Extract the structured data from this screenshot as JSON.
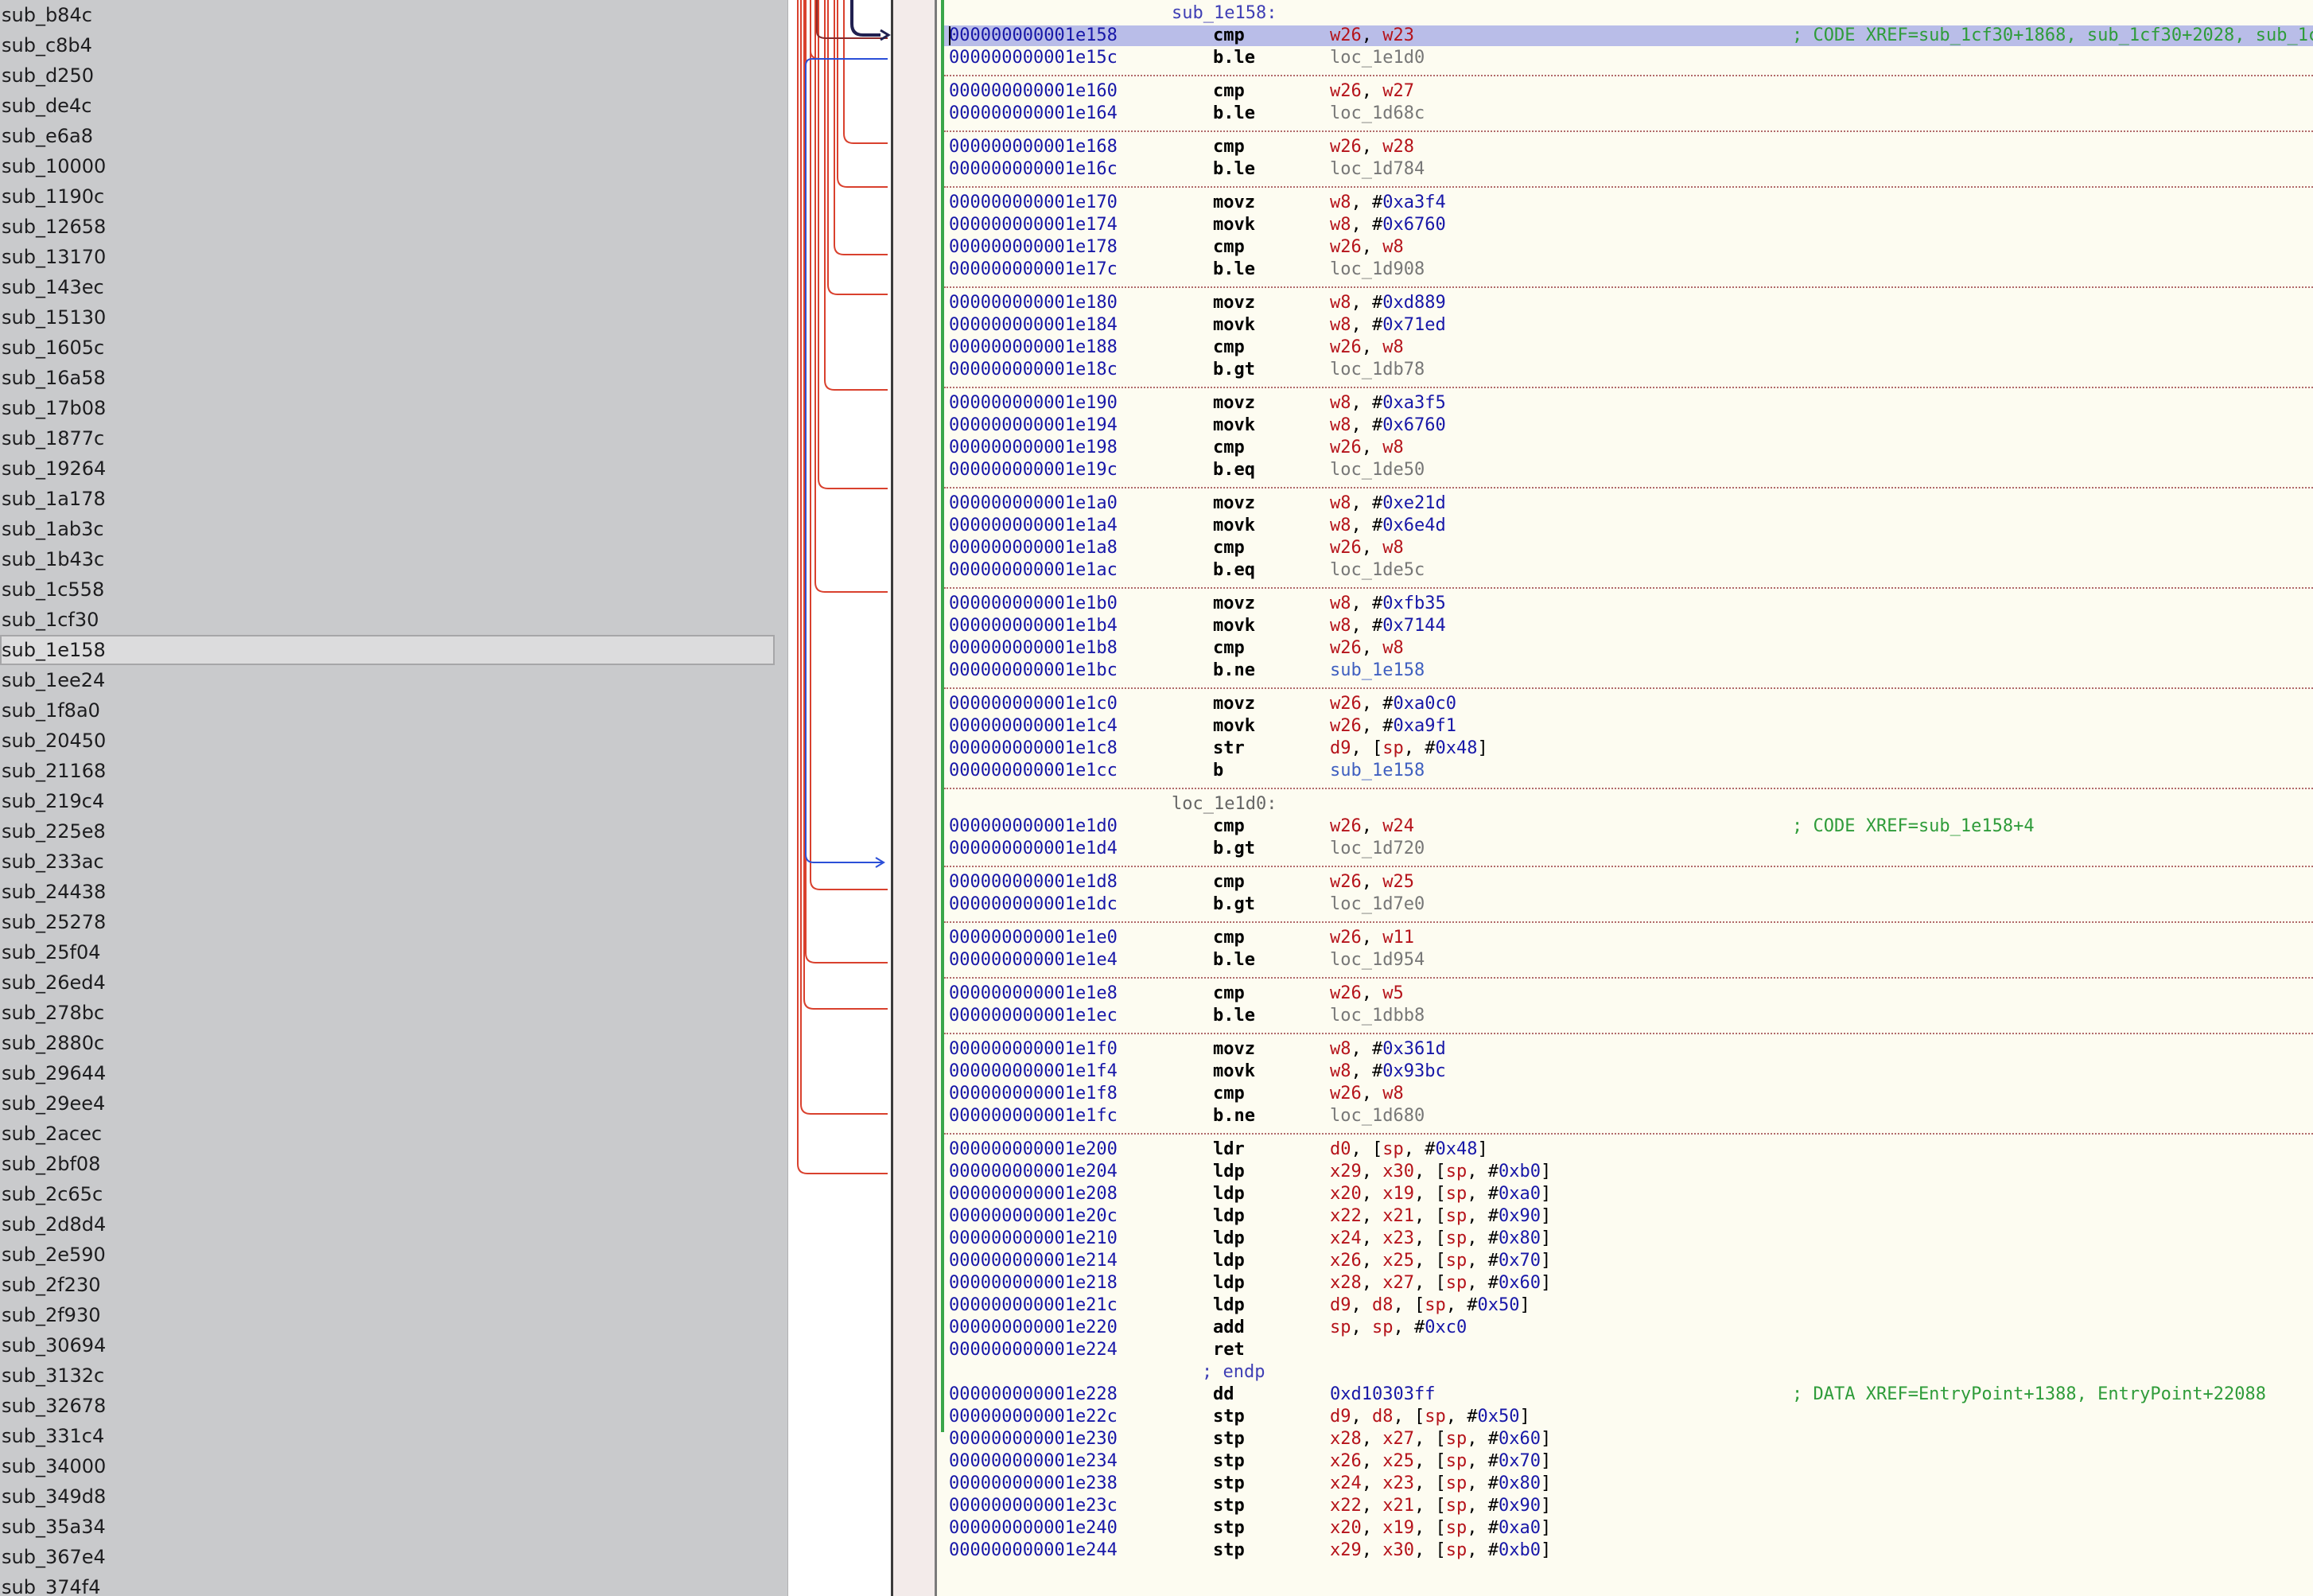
{
  "sidebar": {
    "items": [
      "sub_b84c",
      "sub_c8b4",
      "sub_d250",
      "sub_de4c",
      "sub_e6a8",
      "sub_10000",
      "sub_1190c",
      "sub_12658",
      "sub_13170",
      "sub_143ec",
      "sub_15130",
      "sub_1605c",
      "sub_16a58",
      "sub_17b08",
      "sub_1877c",
      "sub_19264",
      "sub_1a178",
      "sub_1ab3c",
      "sub_1b43c",
      "sub_1c558",
      "sub_1cf30",
      "sub_1e158",
      "sub_1ee24",
      "sub_1f8a0",
      "sub_20450",
      "sub_21168",
      "sub_219c4",
      "sub_225e8",
      "sub_233ac",
      "sub_24438",
      "sub_25278",
      "sub_25f04",
      "sub_26ed4",
      "sub_278bc",
      "sub_2880c",
      "sub_29644",
      "sub_29ee4",
      "sub_2acec",
      "sub_2bf08",
      "sub_2c65c",
      "sub_2d8d4",
      "sub_2e590",
      "sub_2f230",
      "sub_2f930",
      "sub_30694",
      "sub_3132c",
      "sub_32678",
      "sub_331c4",
      "sub_34000",
      "sub_349d8",
      "sub_35a34",
      "sub_367e4",
      "sub_374f4"
    ],
    "selected_index": 21
  },
  "listing": {
    "lines": [
      {
        "kind": "label",
        "text": "sub_1e158:"
      },
      {
        "kind": "code",
        "addr": "000000000001e158",
        "mn": "cmp",
        "ops": "w26, w23",
        "comment": "; CODE XREF=sub_1cf30+1868, sub_1cf30+2028, sub_1c",
        "hl": true
      },
      {
        "kind": "code",
        "addr": "000000000001e15c",
        "mn": "b.le",
        "ops": "loc_1e1d0"
      },
      {
        "kind": "sep"
      },
      {
        "kind": "code",
        "addr": "000000000001e160",
        "mn": "cmp",
        "ops": "w26, w27"
      },
      {
        "kind": "code",
        "addr": "000000000001e164",
        "mn": "b.le",
        "ops": "loc_1d68c"
      },
      {
        "kind": "sep"
      },
      {
        "kind": "code",
        "addr": "000000000001e168",
        "mn": "cmp",
        "ops": "w26, w28"
      },
      {
        "kind": "code",
        "addr": "000000000001e16c",
        "mn": "b.le",
        "ops": "loc_1d784"
      },
      {
        "kind": "sep"
      },
      {
        "kind": "code",
        "addr": "000000000001e170",
        "mn": "movz",
        "ops": "w8, #0xa3f4"
      },
      {
        "kind": "code",
        "addr": "000000000001e174",
        "mn": "movk",
        "ops": "w8, #0x6760"
      },
      {
        "kind": "code",
        "addr": "000000000001e178",
        "mn": "cmp",
        "ops": "w26, w8"
      },
      {
        "kind": "code",
        "addr": "000000000001e17c",
        "mn": "b.le",
        "ops": "loc_1d908"
      },
      {
        "kind": "sep"
      },
      {
        "kind": "code",
        "addr": "000000000001e180",
        "mn": "movz",
        "ops": "w8, #0xd889"
      },
      {
        "kind": "code",
        "addr": "000000000001e184",
        "mn": "movk",
        "ops": "w8, #0x71ed"
      },
      {
        "kind": "code",
        "addr": "000000000001e188",
        "mn": "cmp",
        "ops": "w26, w8"
      },
      {
        "kind": "code",
        "addr": "000000000001e18c",
        "mn": "b.gt",
        "ops": "loc_1db78"
      },
      {
        "kind": "sep"
      },
      {
        "kind": "code",
        "addr": "000000000001e190",
        "mn": "movz",
        "ops": "w8, #0xa3f5"
      },
      {
        "kind": "code",
        "addr": "000000000001e194",
        "mn": "movk",
        "ops": "w8, #0x6760"
      },
      {
        "kind": "code",
        "addr": "000000000001e198",
        "mn": "cmp",
        "ops": "w26, w8"
      },
      {
        "kind": "code",
        "addr": "000000000001e19c",
        "mn": "b.eq",
        "ops": "loc_1de50"
      },
      {
        "kind": "sep"
      },
      {
        "kind": "code",
        "addr": "000000000001e1a0",
        "mn": "movz",
        "ops": "w8, #0xe21d"
      },
      {
        "kind": "code",
        "addr": "000000000001e1a4",
        "mn": "movk",
        "ops": "w8, #0x6e4d"
      },
      {
        "kind": "code",
        "addr": "000000000001e1a8",
        "mn": "cmp",
        "ops": "w26, w8"
      },
      {
        "kind": "code",
        "addr": "000000000001e1ac",
        "mn": "b.eq",
        "ops": "loc_1de5c"
      },
      {
        "kind": "sep"
      },
      {
        "kind": "code",
        "addr": "000000000001e1b0",
        "mn": "movz",
        "ops": "w8, #0xfb35"
      },
      {
        "kind": "code",
        "addr": "000000000001e1b4",
        "mn": "movk",
        "ops": "w8, #0x7144"
      },
      {
        "kind": "code",
        "addr": "000000000001e1b8",
        "mn": "cmp",
        "ops": "w26, w8"
      },
      {
        "kind": "code",
        "addr": "000000000001e1bc",
        "mn": "b.ne",
        "ops": "sub_1e158"
      },
      {
        "kind": "sep"
      },
      {
        "kind": "code",
        "addr": "000000000001e1c0",
        "mn": "movz",
        "ops": "w26, #0xa0c0"
      },
      {
        "kind": "code",
        "addr": "000000000001e1c4",
        "mn": "movk",
        "ops": "w26, #0xa9f1"
      },
      {
        "kind": "code",
        "addr": "000000000001e1c8",
        "mn": "str",
        "ops": "d9, [sp, #0x48]"
      },
      {
        "kind": "code",
        "addr": "000000000001e1cc",
        "mn": "b",
        "ops": "sub_1e158"
      },
      {
        "kind": "sep"
      },
      {
        "kind": "label",
        "text": "loc_1e1d0:",
        "loc": true
      },
      {
        "kind": "code",
        "addr": "000000000001e1d0",
        "mn": "cmp",
        "ops": "w26, w24",
        "comment": "; CODE XREF=sub_1e158+4"
      },
      {
        "kind": "code",
        "addr": "000000000001e1d4",
        "mn": "b.gt",
        "ops": "loc_1d720"
      },
      {
        "kind": "sep"
      },
      {
        "kind": "code",
        "addr": "000000000001e1d8",
        "mn": "cmp",
        "ops": "w26, w25"
      },
      {
        "kind": "code",
        "addr": "000000000001e1dc",
        "mn": "b.gt",
        "ops": "loc_1d7e0"
      },
      {
        "kind": "sep"
      },
      {
        "kind": "code",
        "addr": "000000000001e1e0",
        "mn": "cmp",
        "ops": "w26, w11"
      },
      {
        "kind": "code",
        "addr": "000000000001e1e4",
        "mn": "b.le",
        "ops": "loc_1d954"
      },
      {
        "kind": "sep"
      },
      {
        "kind": "code",
        "addr": "000000000001e1e8",
        "mn": "cmp",
        "ops": "w26, w5"
      },
      {
        "kind": "code",
        "addr": "000000000001e1ec",
        "mn": "b.le",
        "ops": "loc_1dbb8"
      },
      {
        "kind": "sep"
      },
      {
        "kind": "code",
        "addr": "000000000001e1f0",
        "mn": "movz",
        "ops": "w8, #0x361d"
      },
      {
        "kind": "code",
        "addr": "000000000001e1f4",
        "mn": "movk",
        "ops": "w8, #0x93bc"
      },
      {
        "kind": "code",
        "addr": "000000000001e1f8",
        "mn": "cmp",
        "ops": "w26, w8"
      },
      {
        "kind": "code",
        "addr": "000000000001e1fc",
        "mn": "b.ne",
        "ops": "loc_1d680"
      },
      {
        "kind": "sep"
      },
      {
        "kind": "code",
        "addr": "000000000001e200",
        "mn": "ldr",
        "ops": "d0, [sp, #0x48]"
      },
      {
        "kind": "code",
        "addr": "000000000001e204",
        "mn": "ldp",
        "ops": "x29, x30, [sp, #0xb0]"
      },
      {
        "kind": "code",
        "addr": "000000000001e208",
        "mn": "ldp",
        "ops": "x20, x19, [sp, #0xa0]"
      },
      {
        "kind": "code",
        "addr": "000000000001e20c",
        "mn": "ldp",
        "ops": "x22, x21, [sp, #0x90]"
      },
      {
        "kind": "code",
        "addr": "000000000001e210",
        "mn": "ldp",
        "ops": "x24, x23, [sp, #0x80]"
      },
      {
        "kind": "code",
        "addr": "000000000001e214",
        "mn": "ldp",
        "ops": "x26, x25, [sp, #0x70]"
      },
      {
        "kind": "code",
        "addr": "000000000001e218",
        "mn": "ldp",
        "ops": "x28, x27, [sp, #0x60]"
      },
      {
        "kind": "code",
        "addr": "000000000001e21c",
        "mn": "ldp",
        "ops": "d9, d8, [sp, #0x50]"
      },
      {
        "kind": "code",
        "addr": "000000000001e220",
        "mn": "add",
        "ops": "sp, sp, #0xc0"
      },
      {
        "kind": "code",
        "addr": "000000000001e224",
        "mn": "ret",
        "ops": ""
      },
      {
        "kind": "endp",
        "text": "; endp"
      },
      {
        "kind": "code",
        "addr": "000000000001e228",
        "mn": "dd",
        "ops": "0xd10303ff",
        "comment": "; DATA XREF=EntryPoint+1388, EntryPoint+22088"
      },
      {
        "kind": "code",
        "addr": "000000000001e22c",
        "mn": "stp",
        "ops": "d9, d8, [sp, #0x50]"
      },
      {
        "kind": "code",
        "addr": "000000000001e230",
        "mn": "stp",
        "ops": "x28, x27, [sp, #0x60]"
      },
      {
        "kind": "code",
        "addr": "000000000001e234",
        "mn": "stp",
        "ops": "x26, x25, [sp, #0x70]"
      },
      {
        "kind": "code",
        "addr": "000000000001e238",
        "mn": "stp",
        "ops": "x24, x23, [sp, #0x80]"
      },
      {
        "kind": "code",
        "addr": "000000000001e23c",
        "mn": "stp",
        "ops": "x22, x21, [sp, #0x90]"
      },
      {
        "kind": "code",
        "addr": "000000000001e240",
        "mn": "stp",
        "ops": "x20, x19, [sp, #0xa0]"
      },
      {
        "kind": "code",
        "addr": "000000000001e244",
        "mn": "stp",
        "ops": "x29, x30, [sp, #0xb0]"
      }
    ]
  },
  "colors": {
    "register": "#b5131a",
    "immediate": "#1717a8",
    "address": "#1717a8",
    "comment": "#2f9c3a",
    "highlight": "#b9bde8",
    "branch_red": "#d9412e",
    "branch_blue": "#2b4fd8"
  }
}
